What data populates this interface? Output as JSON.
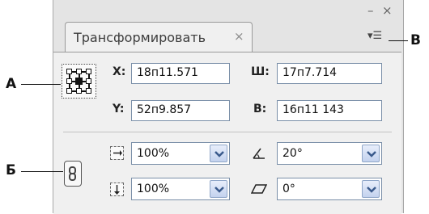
{
  "window": {
    "minimize_glyph": "–",
    "close_glyph": "×"
  },
  "tab": {
    "title": "Трансформировать",
    "close_glyph": "×"
  },
  "menu_button": {
    "glyph": "▾☰"
  },
  "callouts": {
    "a": "А",
    "b": "Б",
    "v": "В"
  },
  "fields": {
    "x": {
      "label": "X:",
      "value": "18п11.571"
    },
    "y": {
      "label": "Y:",
      "value": "52п9.857"
    },
    "w": {
      "label": "Ш:",
      "value": "17п7.714"
    },
    "h": {
      "label": "В:",
      "value": "16п11 143"
    }
  },
  "scale": {
    "x": {
      "value": "100%"
    },
    "y": {
      "value": "100%"
    }
  },
  "rotate": {
    "value": "20°"
  },
  "shear": {
    "value": "0°"
  },
  "icons": {
    "reference_point": "reference-point-grid-icon",
    "constrain": "chain-link-icon",
    "scale_x": "scale-x-icon",
    "scale_y": "scale-y-icon",
    "rotate": "rotate-angle-icon",
    "shear": "shear-icon",
    "dropdown": "chevron-down-icon"
  }
}
